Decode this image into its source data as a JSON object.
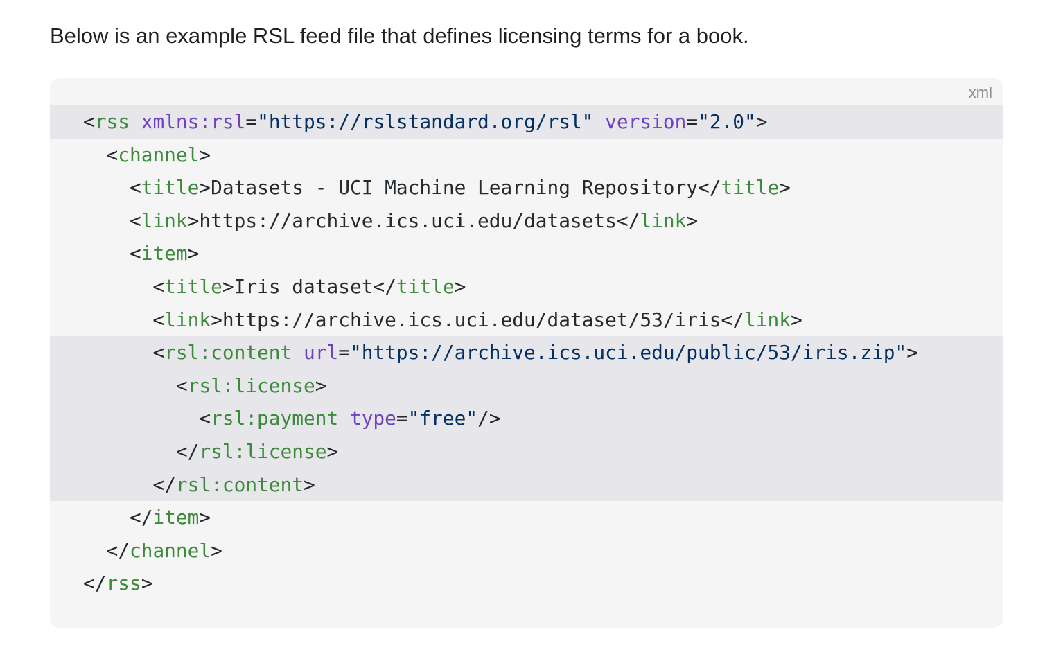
{
  "intro": "Below is an example RSL feed file that defines licensing terms for a book.",
  "code_block": {
    "language": "xml",
    "lines": [
      {
        "highlight": true,
        "tokens": [
          [
            "punct",
            "<"
          ],
          [
            "tag",
            "rss"
          ],
          [
            "txt",
            " "
          ],
          [
            "attr",
            "xmlns:rsl"
          ],
          [
            "punct",
            "="
          ],
          [
            "str",
            "\"https://rslstandard.org/rsl\""
          ],
          [
            "txt",
            " "
          ],
          [
            "attr",
            "version"
          ],
          [
            "punct",
            "="
          ],
          [
            "str",
            "\"2.0\""
          ],
          [
            "punct",
            ">"
          ]
        ]
      },
      {
        "highlight": false,
        "tokens": [
          [
            "txt",
            "  "
          ],
          [
            "punct",
            "<"
          ],
          [
            "tag",
            "channel"
          ],
          [
            "punct",
            ">"
          ]
        ]
      },
      {
        "highlight": false,
        "tokens": [
          [
            "txt",
            "    "
          ],
          [
            "punct",
            "<"
          ],
          [
            "tag",
            "title"
          ],
          [
            "punct",
            ">"
          ],
          [
            "txt",
            "Datasets - UCI Machine Learning Repository"
          ],
          [
            "punct",
            "</"
          ],
          [
            "tag",
            "title"
          ],
          [
            "punct",
            ">"
          ]
        ]
      },
      {
        "highlight": false,
        "tokens": [
          [
            "txt",
            "    "
          ],
          [
            "punct",
            "<"
          ],
          [
            "tag",
            "link"
          ],
          [
            "punct",
            ">"
          ],
          [
            "txt",
            "https://archive.ics.uci.edu/datasets"
          ],
          [
            "punct",
            "</"
          ],
          [
            "tag",
            "link"
          ],
          [
            "punct",
            ">"
          ]
        ]
      },
      {
        "highlight": false,
        "tokens": [
          [
            "txt",
            "    "
          ],
          [
            "punct",
            "<"
          ],
          [
            "tag",
            "item"
          ],
          [
            "punct",
            ">"
          ]
        ]
      },
      {
        "highlight": false,
        "tokens": [
          [
            "txt",
            "      "
          ],
          [
            "punct",
            "<"
          ],
          [
            "tag",
            "title"
          ],
          [
            "punct",
            ">"
          ],
          [
            "txt",
            "Iris dataset"
          ],
          [
            "punct",
            "</"
          ],
          [
            "tag",
            "title"
          ],
          [
            "punct",
            ">"
          ]
        ]
      },
      {
        "highlight": false,
        "tokens": [
          [
            "txt",
            "      "
          ],
          [
            "punct",
            "<"
          ],
          [
            "tag",
            "link"
          ],
          [
            "punct",
            ">"
          ],
          [
            "txt",
            "https://archive.ics.uci.edu/dataset/53/iris"
          ],
          [
            "punct",
            "</"
          ],
          [
            "tag",
            "link"
          ],
          [
            "punct",
            ">"
          ]
        ]
      },
      {
        "highlight": true,
        "tokens": [
          [
            "txt",
            "      "
          ],
          [
            "punct",
            "<"
          ],
          [
            "tag",
            "rsl:content"
          ],
          [
            "txt",
            " "
          ],
          [
            "attr",
            "url"
          ],
          [
            "punct",
            "="
          ],
          [
            "str",
            "\"https://archive.ics.uci.edu/public/53/iris.zip\""
          ],
          [
            "punct",
            ">"
          ]
        ]
      },
      {
        "highlight": true,
        "tokens": [
          [
            "txt",
            "        "
          ],
          [
            "punct",
            "<"
          ],
          [
            "tag",
            "rsl:license"
          ],
          [
            "punct",
            ">"
          ]
        ]
      },
      {
        "highlight": true,
        "tokens": [
          [
            "txt",
            "          "
          ],
          [
            "punct",
            "<"
          ],
          [
            "tag",
            "rsl:payment"
          ],
          [
            "txt",
            " "
          ],
          [
            "attr",
            "type"
          ],
          [
            "punct",
            "="
          ],
          [
            "str",
            "\"free\""
          ],
          [
            "punct",
            "/>"
          ]
        ]
      },
      {
        "highlight": true,
        "tokens": [
          [
            "txt",
            "        "
          ],
          [
            "punct",
            "</"
          ],
          [
            "tag",
            "rsl:license"
          ],
          [
            "punct",
            ">"
          ]
        ]
      },
      {
        "highlight": true,
        "tokens": [
          [
            "txt",
            "      "
          ],
          [
            "punct",
            "</"
          ],
          [
            "tag",
            "rsl:content"
          ],
          [
            "punct",
            ">"
          ]
        ]
      },
      {
        "highlight": false,
        "tokens": [
          [
            "txt",
            "    "
          ],
          [
            "punct",
            "</"
          ],
          [
            "tag",
            "item"
          ],
          [
            "punct",
            ">"
          ]
        ]
      },
      {
        "highlight": false,
        "tokens": [
          [
            "txt",
            "  "
          ],
          [
            "punct",
            "</"
          ],
          [
            "tag",
            "channel"
          ],
          [
            "punct",
            ">"
          ]
        ]
      },
      {
        "highlight": false,
        "tokens": [
          [
            "punct",
            "</"
          ],
          [
            "tag",
            "rss"
          ],
          [
            "punct",
            ">"
          ]
        ]
      }
    ]
  }
}
